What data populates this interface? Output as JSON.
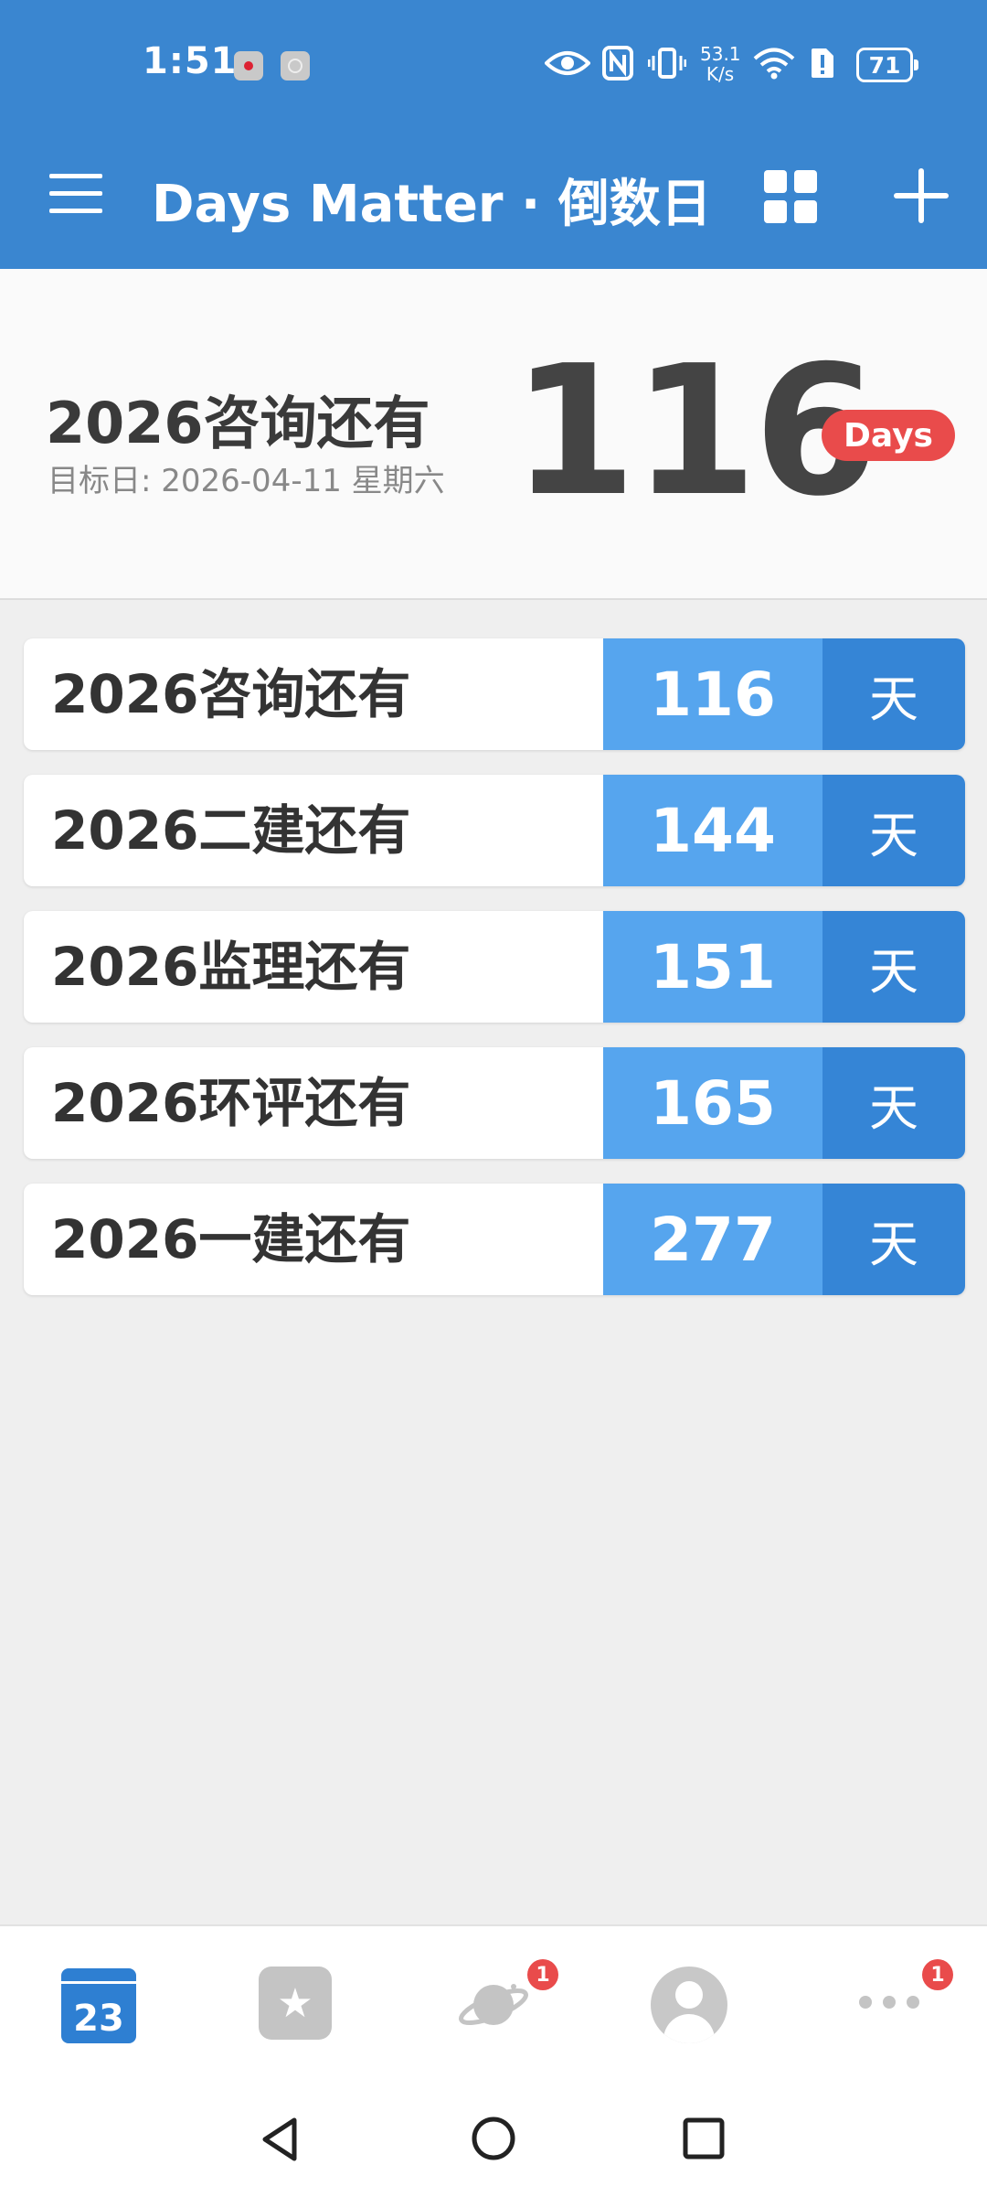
{
  "status_bar": {
    "time": "1:51",
    "net_speed_value": "53.1",
    "net_speed_unit": "K/s",
    "battery": "71"
  },
  "app_bar": {
    "title": "Days Matter · 倒数日"
  },
  "hero": {
    "title": "2026咨询还有",
    "target_date": "目标日: 2026-04-11 星期六",
    "days_count": "116",
    "days_label": "Days"
  },
  "events": [
    {
      "label": "2026咨询还有",
      "days": "116",
      "unit": "天"
    },
    {
      "label": "2026二建还有",
      "days": "144",
      "unit": "天"
    },
    {
      "label": "2026监理还有",
      "days": "151",
      "unit": "天"
    },
    {
      "label": "2026环评还有",
      "days": "165",
      "unit": "天"
    },
    {
      "label": "2026一建还有",
      "days": "277",
      "unit": "天"
    }
  ],
  "bottom_nav": {
    "calendar_day": "23",
    "planet_badge": "1",
    "more_badge": "1"
  },
  "colors": {
    "app_bar": "#3a86d0",
    "days_cell": "#56a5ee",
    "unit_cell": "#3585d6",
    "badge_red": "#e94b4b"
  }
}
